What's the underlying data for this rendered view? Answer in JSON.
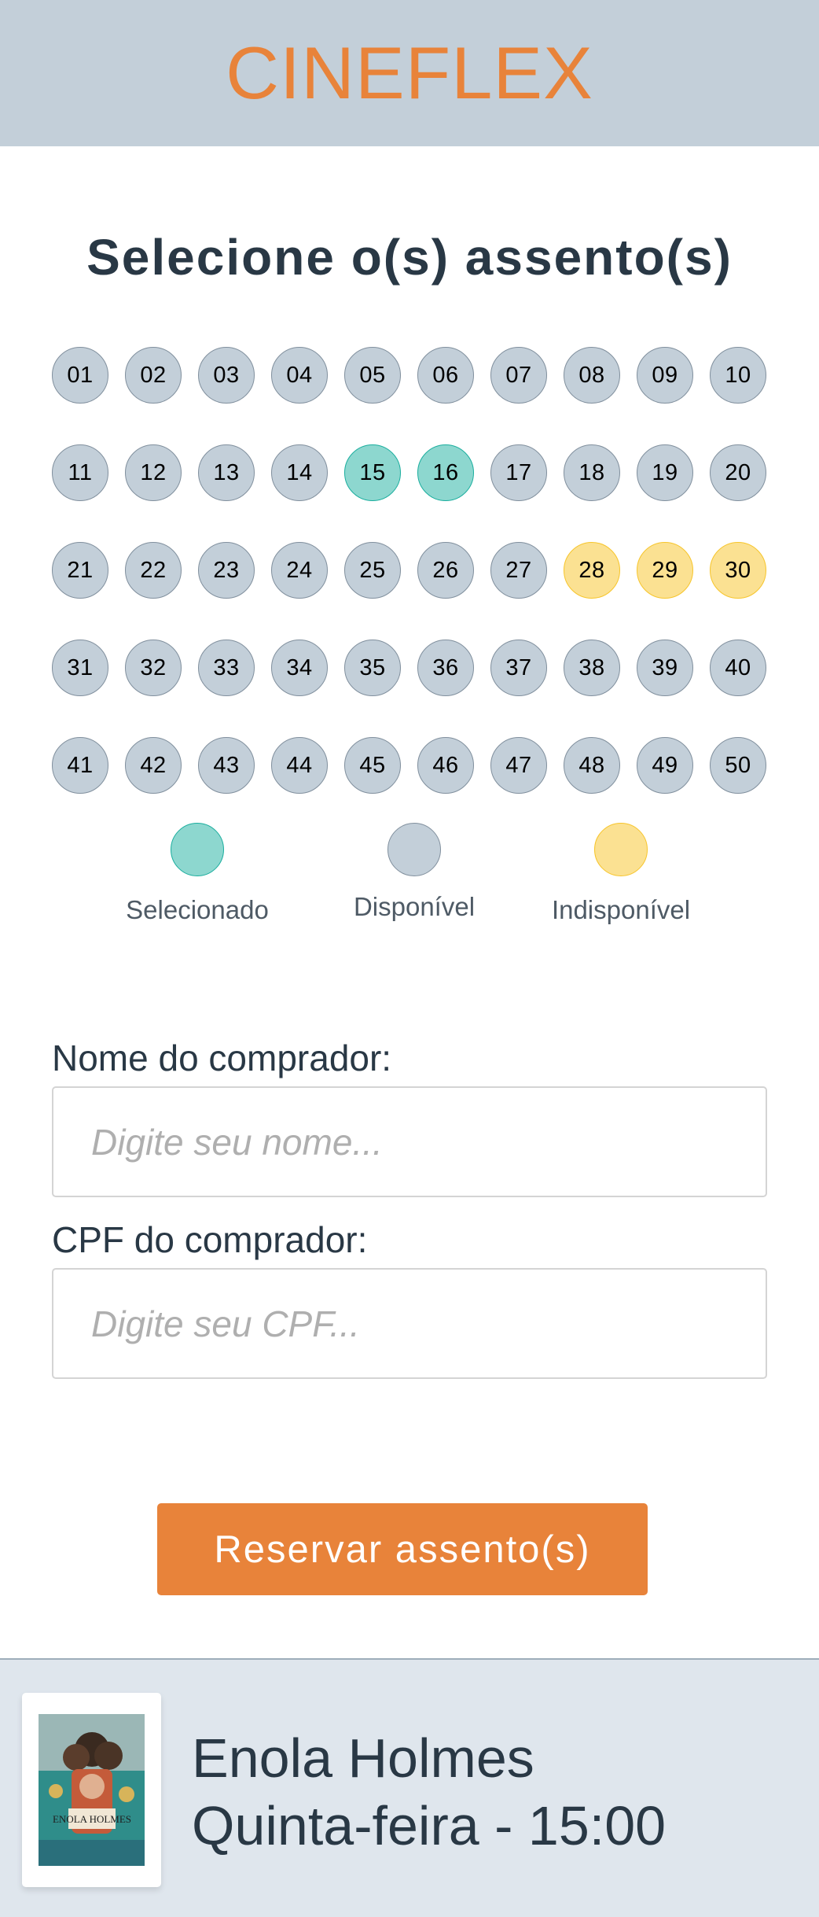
{
  "header": {
    "brand": "CINEFLEX"
  },
  "page": {
    "title": "Selecione o(s) assento(s)"
  },
  "seats": [
    {
      "label": "01",
      "status": "available"
    },
    {
      "label": "02",
      "status": "available"
    },
    {
      "label": "03",
      "status": "available"
    },
    {
      "label": "04",
      "status": "available"
    },
    {
      "label": "05",
      "status": "available"
    },
    {
      "label": "06",
      "status": "available"
    },
    {
      "label": "07",
      "status": "available"
    },
    {
      "label": "08",
      "status": "available"
    },
    {
      "label": "09",
      "status": "available"
    },
    {
      "label": "10",
      "status": "available"
    },
    {
      "label": "11",
      "status": "available"
    },
    {
      "label": "12",
      "status": "available"
    },
    {
      "label": "13",
      "status": "available"
    },
    {
      "label": "14",
      "status": "available"
    },
    {
      "label": "15",
      "status": "selected"
    },
    {
      "label": "16",
      "status": "selected"
    },
    {
      "label": "17",
      "status": "available"
    },
    {
      "label": "18",
      "status": "available"
    },
    {
      "label": "19",
      "status": "available"
    },
    {
      "label": "20",
      "status": "available"
    },
    {
      "label": "21",
      "status": "available"
    },
    {
      "label": "22",
      "status": "available"
    },
    {
      "label": "23",
      "status": "available"
    },
    {
      "label": "24",
      "status": "available"
    },
    {
      "label": "25",
      "status": "available"
    },
    {
      "label": "26",
      "status": "available"
    },
    {
      "label": "27",
      "status": "available"
    },
    {
      "label": "28",
      "status": "unavailable"
    },
    {
      "label": "29",
      "status": "unavailable"
    },
    {
      "label": "30",
      "status": "unavailable"
    },
    {
      "label": "31",
      "status": "available"
    },
    {
      "label": "32",
      "status": "available"
    },
    {
      "label": "33",
      "status": "available"
    },
    {
      "label": "34",
      "status": "available"
    },
    {
      "label": "35",
      "status": "available"
    },
    {
      "label": "36",
      "status": "available"
    },
    {
      "label": "37",
      "status": "available"
    },
    {
      "label": "38",
      "status": "available"
    },
    {
      "label": "39",
      "status": "available"
    },
    {
      "label": "40",
      "status": "available"
    },
    {
      "label": "41",
      "status": "available"
    },
    {
      "label": "42",
      "status": "available"
    },
    {
      "label": "43",
      "status": "available"
    },
    {
      "label": "44",
      "status": "available"
    },
    {
      "label": "45",
      "status": "available"
    },
    {
      "label": "46",
      "status": "available"
    },
    {
      "label": "47",
      "status": "available"
    },
    {
      "label": "48",
      "status": "available"
    },
    {
      "label": "49",
      "status": "available"
    },
    {
      "label": "50",
      "status": "available"
    }
  ],
  "legend": {
    "selected": "Selecionado",
    "available": "Disponível",
    "unavailable": "Indisponível"
  },
  "form": {
    "name_label": "Nome do comprador:",
    "name_placeholder": "Digite seu nome...",
    "name_value": "",
    "cpf_label": "CPF do comprador:",
    "cpf_placeholder": "Digite seu CPF...",
    "cpf_value": ""
  },
  "actions": {
    "reserve_label": "Reservar assento(s)"
  },
  "footer": {
    "movie_title": "Enola Holmes",
    "session": "Quinta-feira - 15:00",
    "poster_icon": "movie-poster-icon",
    "poster_text": "ENOLA HOLMES"
  },
  "colors": {
    "brand": "#E8833A",
    "header_bg": "#C3CFD9",
    "seat_available": "#C3CFD9",
    "seat_selected": "#8DD7CF",
    "seat_unavailable": "#FBE192",
    "footer_bg": "#DFE6ED",
    "text": "#293845"
  }
}
